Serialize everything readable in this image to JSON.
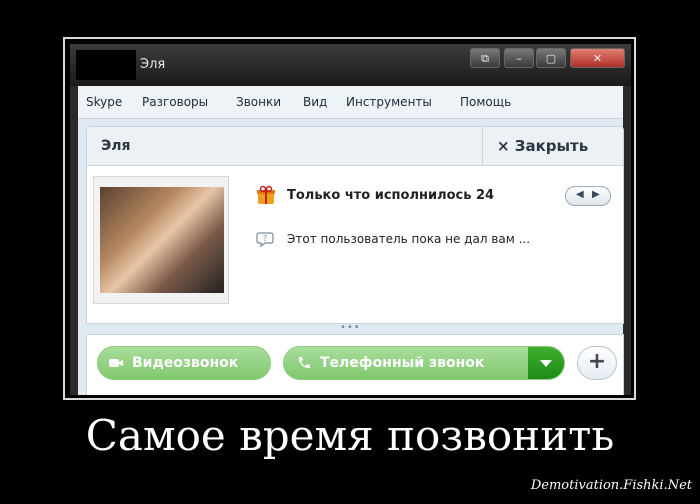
{
  "window": {
    "title": "Эля",
    "controls": {
      "restore": "⧉",
      "minimize": "–",
      "maximize": "▢",
      "close": "✕"
    }
  },
  "menu": [
    "Skype",
    "Разговоры",
    "Звонки",
    "Вид",
    "Инструменты",
    "Помощь"
  ],
  "header": {
    "contact_name": "Эля",
    "close_label": "× Закрыть"
  },
  "profile": {
    "birthday_text": "Только что исполнилось 24",
    "mood_text": "Этот пользователь пока не дал вам ...",
    "nav_prev": "◀",
    "nav_next": "▶"
  },
  "actions": {
    "video_call": "Видеозвонок",
    "phone_call": "Телефонный звонок",
    "more": "+"
  },
  "caption": "Самое время позвонить",
  "watermark": "Demotivation.Fishki.Net",
  "colors": {
    "call_green": "#7fc86d",
    "dropdown_green": "#1f8a16",
    "gift_orange": "#f0a020"
  }
}
